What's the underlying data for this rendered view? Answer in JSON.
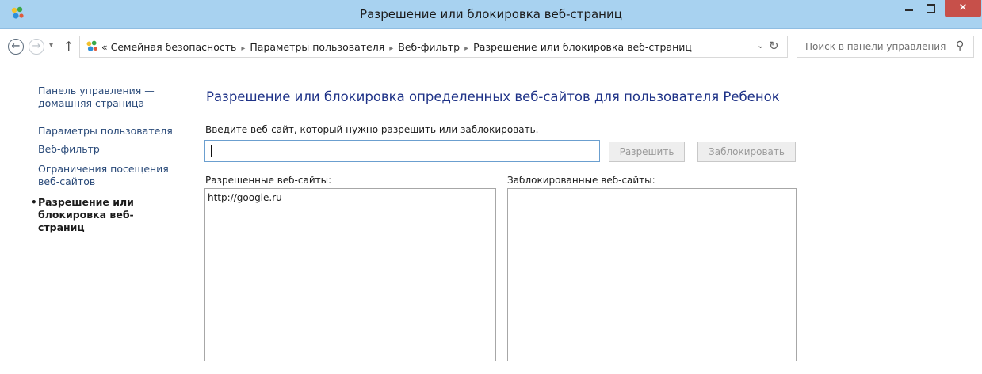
{
  "window": {
    "title": "Разрешение или блокировка веб-страниц",
    "minimize_icon": "minimize-icon",
    "maximize_icon": "maximize-icon",
    "close_glyph": "×"
  },
  "nav": {
    "back_glyph": "←",
    "forward_glyph": "→",
    "history_glyph": "▾",
    "up_glyph": "↑",
    "breadcrumb": {
      "prefix": "«",
      "items": [
        "Семейная безопасность",
        "Параметры пользователя",
        "Веб-фильтр",
        "Разрешение или блокировка веб-страниц"
      ],
      "separator": "▸"
    },
    "dropdown_glyph": "⌄",
    "refresh_glyph": "↻",
    "search_placeholder": "Поиск в панели управления",
    "search_glyph": "⚲"
  },
  "sidebar": {
    "items": [
      "Панель управления —",
      "домашняя страница",
      "Параметры пользователя",
      "Веб-фильтр",
      "Ограничения посещения",
      "веб-сайтов"
    ],
    "active": [
      "Разрешение или",
      "блокировка веб-страниц"
    ],
    "bullet": "•"
  },
  "main": {
    "title": "Разрешение или блокировка определенных веб-сайтов для пользователя Ребенок",
    "instruction": "Введите веб-сайт, который нужно разрешить или заблокировать.",
    "input_value": "",
    "allow_button": "Разрешить",
    "block_button": "Заблокировать",
    "allowed_label": "Разрешенные веб-сайты:",
    "blocked_label": "Заблокированные веб-сайты:",
    "allowed_sites": [
      "http://google.ru"
    ],
    "blocked_sites": []
  },
  "colors": {
    "titlebar": "#a8d2f0",
    "close_button": "#c7504a",
    "link": "#2a4a79",
    "heading": "#1e3287"
  }
}
